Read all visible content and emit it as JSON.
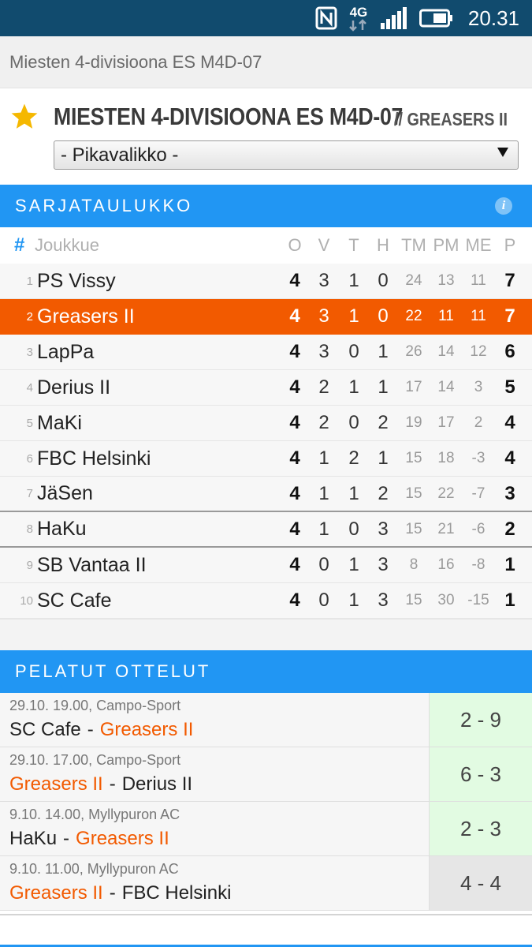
{
  "status_bar": {
    "icons": [
      "nfc-icon",
      "network-4g-icon",
      "signal-icon",
      "battery-icon"
    ],
    "network_label": "4G",
    "time": "20.31"
  },
  "breadcrumb": "Miesten 4-divisioona ES M4D-07",
  "header": {
    "title": "MIESTEN 4-DIVISIOONA ES M4D-07",
    "team": "// GREASERS II",
    "quick_select": "- Pikavalikko -",
    "favorite_icon": "star-icon"
  },
  "standings": {
    "section_title": "SARJATAULUKKO",
    "info_icon": "info-icon",
    "columns": {
      "rank": "#",
      "team": "Joukkue",
      "o": "O",
      "v": "V",
      "t": "T",
      "h": "H",
      "tm": "TM",
      "pm": "PM",
      "me": "ME",
      "p": "P"
    },
    "rows": [
      {
        "rank": "1",
        "team": "PS Vissy",
        "o": "4",
        "v": "3",
        "t": "1",
        "h": "0",
        "tm": "24",
        "pm": "13",
        "me": "11",
        "p": "7"
      },
      {
        "rank": "2",
        "team": "Greasers II",
        "o": "4",
        "v": "3",
        "t": "1",
        "h": "0",
        "tm": "22",
        "pm": "11",
        "me": "11",
        "p": "7"
      },
      {
        "rank": "3",
        "team": "LapPa",
        "o": "4",
        "v": "3",
        "t": "0",
        "h": "1",
        "tm": "26",
        "pm": "14",
        "me": "12",
        "p": "6"
      },
      {
        "rank": "4",
        "team": "Derius II",
        "o": "4",
        "v": "2",
        "t": "1",
        "h": "1",
        "tm": "17",
        "pm": "14",
        "me": "3",
        "p": "5"
      },
      {
        "rank": "5",
        "team": "MaKi",
        "o": "4",
        "v": "2",
        "t": "0",
        "h": "2",
        "tm": "19",
        "pm": "17",
        "me": "2",
        "p": "4"
      },
      {
        "rank": "6",
        "team": "FBC Helsinki",
        "o": "4",
        "v": "1",
        "t": "2",
        "h": "1",
        "tm": "15",
        "pm": "18",
        "me": "-3",
        "p": "4"
      },
      {
        "rank": "7",
        "team": "JäSen",
        "o": "4",
        "v": "1",
        "t": "1",
        "h": "2",
        "tm": "15",
        "pm": "22",
        "me": "-7",
        "p": "3"
      },
      {
        "rank": "8",
        "team": "HaKu",
        "o": "4",
        "v": "1",
        "t": "0",
        "h": "3",
        "tm": "15",
        "pm": "21",
        "me": "-6",
        "p": "2"
      },
      {
        "rank": "9",
        "team": "SB Vantaa II",
        "o": "4",
        "v": "0",
        "t": "1",
        "h": "3",
        "tm": "8",
        "pm": "16",
        "me": "-8",
        "p": "1"
      },
      {
        "rank": "10",
        "team": "SC Cafe",
        "o": "4",
        "v": "0",
        "t": "1",
        "h": "3",
        "tm": "15",
        "pm": "30",
        "me": "-15",
        "p": "1"
      }
    ]
  },
  "matches": {
    "section_title": "PELATUT OTTELUT",
    "items": [
      {
        "info": "29.10. 19.00, Campo-Sport",
        "home": "SC Cafe",
        "away": "Greasers II",
        "separator": "-",
        "score": "2 - 9",
        "result": "win"
      },
      {
        "info": "29.10. 17.00, Campo-Sport",
        "home": "Greasers II",
        "away": "Derius II",
        "separator": "-",
        "score": "6 - 3",
        "result": "win"
      },
      {
        "info": "9.10. 14.00, Myllypuron AC",
        "home": "HaKu",
        "away": "Greasers II",
        "separator": "-",
        "score": "2 - 3",
        "result": "win"
      },
      {
        "info": "9.10. 11.00, Myllypuron AC",
        "home": "Greasers II",
        "away": "FBC Helsinki",
        "separator": "-",
        "score": "4 - 4",
        "result": "draw"
      }
    ]
  },
  "colors": {
    "status_bar": "#114b6e",
    "section_header": "#2196f3",
    "highlight": "#f25a00",
    "win_bg": "#e2fbe2",
    "draw_bg": "#e6e6e6",
    "star": "#f5b800"
  }
}
